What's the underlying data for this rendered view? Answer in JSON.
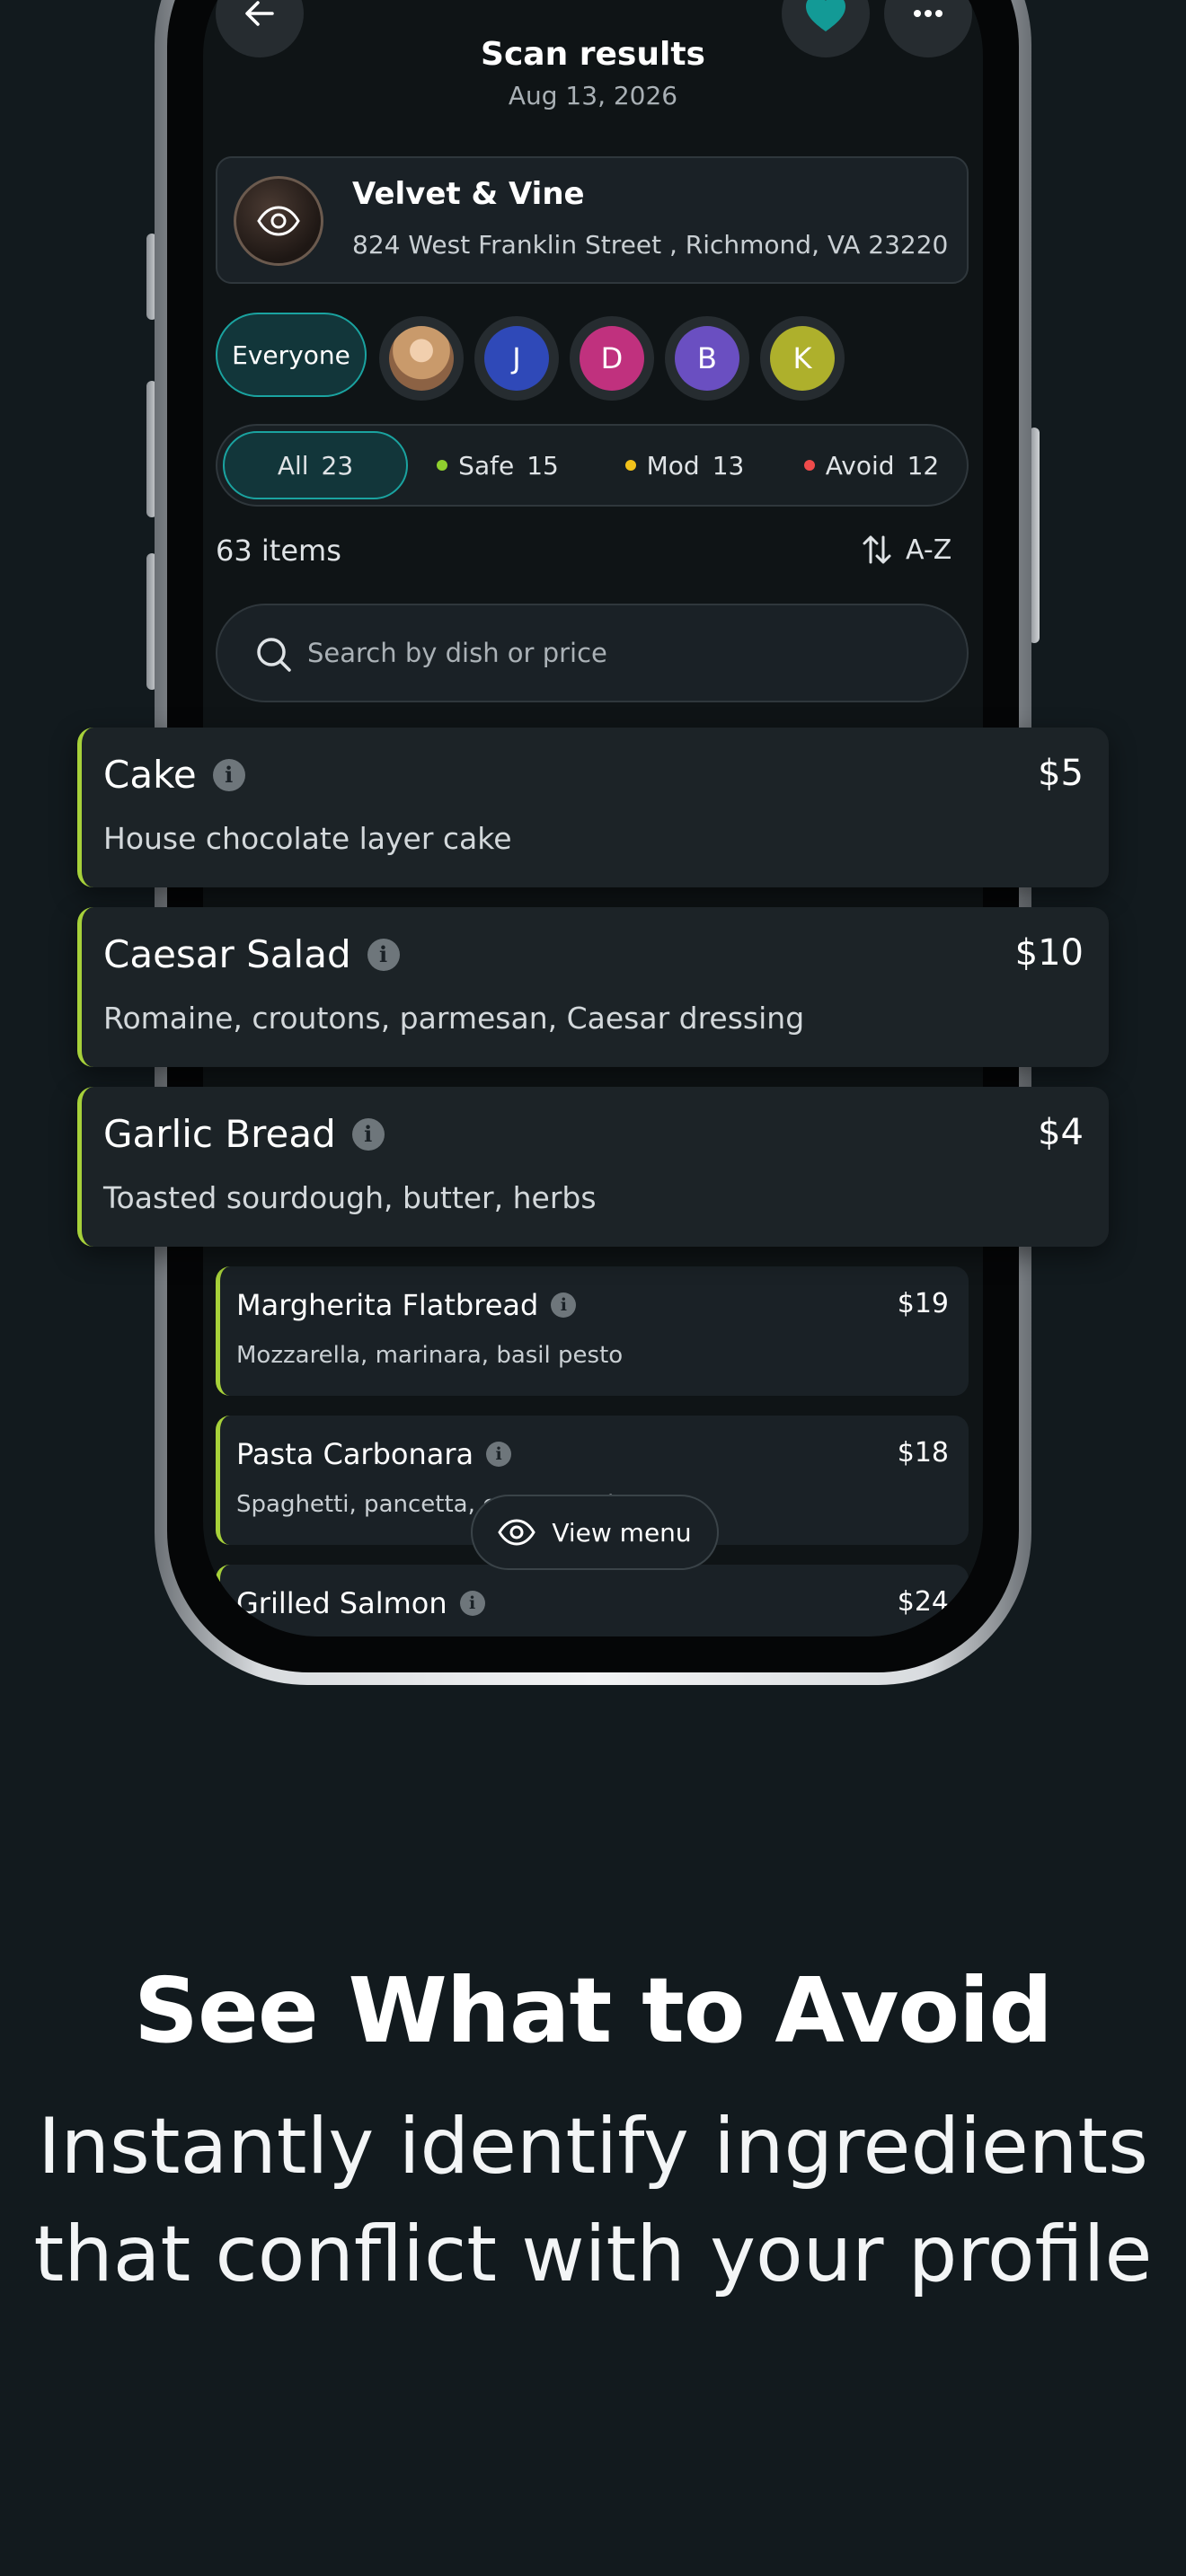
{
  "header": {
    "title": "Scan results",
    "date": "Aug 13, 2026"
  },
  "restaurant": {
    "name": "Velvet & Vine",
    "address": "824 West Franklin Street , Richmond, VA 23220"
  },
  "people": {
    "everyone_label": "Everyone",
    "members": [
      {
        "initial": "",
        "color": "#c99a6b"
      },
      {
        "initial": "J",
        "color": "#2f49b8"
      },
      {
        "initial": "D",
        "color": "#c0317e"
      },
      {
        "initial": "B",
        "color": "#6a4fc1"
      },
      {
        "initial": "K",
        "color": "#aeb02c"
      }
    ]
  },
  "filters": [
    {
      "label": "All",
      "count": "23",
      "dot": ""
    },
    {
      "label": "Safe",
      "count": "15",
      "dot": "#8fcf2e"
    },
    {
      "label": "Mod",
      "count": "13",
      "dot": "#f2c21b"
    },
    {
      "label": "Avoid",
      "count": "12",
      "dot": "#ef4b4b"
    }
  ],
  "list": {
    "count_label": "63 items",
    "sort_label": "A-Z",
    "search_placeholder": "Search by dish or price"
  },
  "featured_items": [
    {
      "name": "Cake",
      "price": "$5",
      "desc": "House chocolate layer cake"
    },
    {
      "name": "Caesar Salad",
      "price": "$10",
      "desc": "Romaine, croutons, parmesan, Caesar dressing"
    },
    {
      "name": "Garlic Bread",
      "price": "$4",
      "desc": "Toasted sourdough, butter, herbs"
    }
  ],
  "menu_items": [
    {
      "name": "Margherita Flatbread",
      "price": "$19",
      "desc": "Mozzarella, marinara, basil pesto"
    },
    {
      "name": "Pasta Carbonara",
      "price": "$18",
      "desc": "Spaghetti, pancetta, egg, pecorino"
    },
    {
      "name": "Grilled Salmon",
      "price": "$24",
      "desc": "..."
    }
  ],
  "view_menu_label": "View menu",
  "marketing": {
    "headline": "See What to Avoid",
    "sub_line1": "Instantly identify ingredients",
    "sub_line2": "that conflict with your profile"
  },
  "colors": {
    "accent_teal": "#1aa3a0",
    "safe_green": "#a7d13a",
    "heart": "#139a96"
  }
}
